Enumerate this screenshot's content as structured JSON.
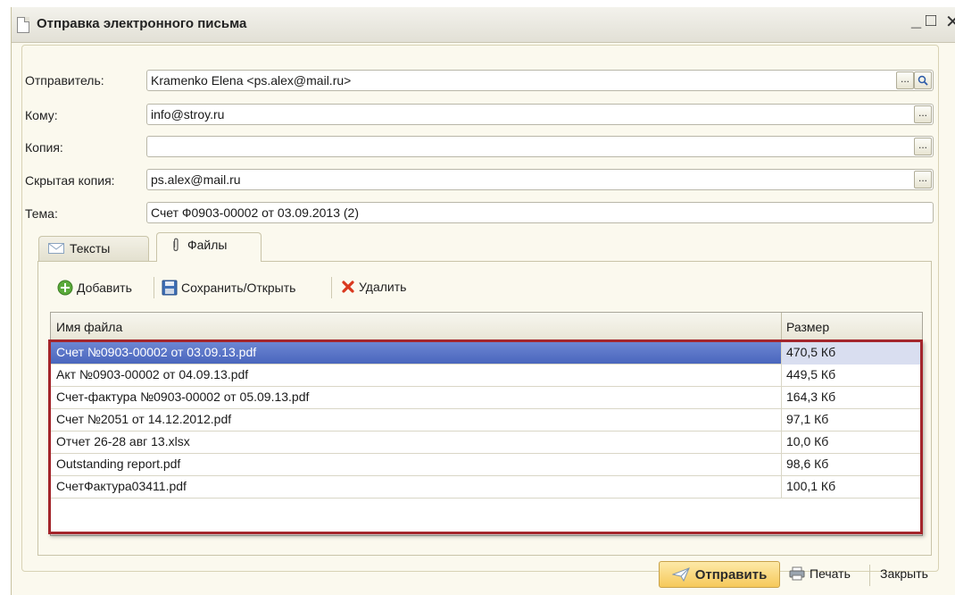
{
  "window": {
    "title": "Отправка электронного письма",
    "minimize": "_",
    "maximize": "□",
    "close": "✕"
  },
  "form": {
    "sender": {
      "label": "Отправитель:",
      "value": "Kramenko Elena <ps.alex@mail.ru>"
    },
    "to": {
      "label": "Кому:",
      "value": "info@stroy.ru"
    },
    "cc": {
      "label": "Копия:",
      "value": ""
    },
    "bcc": {
      "label": "Скрытая копия:",
      "value": "ps.alex@mail.ru"
    },
    "subject": {
      "label": "Тема:",
      "value": "Счет Ф0903-00002 от 03.09.2013 (2)"
    },
    "select_button": "...",
    "search_icon": "magnifier-icon"
  },
  "tabs": [
    {
      "label": "Тексты",
      "icon": "envelope-icon"
    },
    {
      "label": "Файлы",
      "icon": "paperclip-icon"
    }
  ],
  "toolbar": {
    "add": "Добавить",
    "save_open": "Сохранить/Открыть",
    "delete": "Удалить"
  },
  "files": {
    "columns": {
      "name": "Имя файла",
      "size": "Размер"
    },
    "rows": [
      {
        "name": "Счет №0903-00002 от 03.09.13.pdf",
        "size": "470,5 Кб"
      },
      {
        "name": "Акт №0903-00002 от 04.09.13.pdf",
        "size": "449,5 Кб"
      },
      {
        "name": "Счет-фактура №0903-00002 от 05.09.13.pdf",
        "size": "164,3 Кб"
      },
      {
        "name": "Счет №2051 от 14.12.2012.pdf",
        "size": "97,1 Кб"
      },
      {
        "name": "Отчет 26-28 авг 13.xlsx",
        "size": "10,0 Кб"
      },
      {
        "name": "Outstanding report.pdf",
        "size": "98,6 Кб"
      },
      {
        "name": "СчетФактура03411.pdf",
        "size": "100,1 Кб"
      }
    ]
  },
  "footer": {
    "send": "Отправить",
    "print": "Печать",
    "close": "Закрыть"
  },
  "colors": {
    "accent_selection": "#4a66bd",
    "highlight_border": "#a4262c",
    "send_button": "#f6c95a"
  }
}
